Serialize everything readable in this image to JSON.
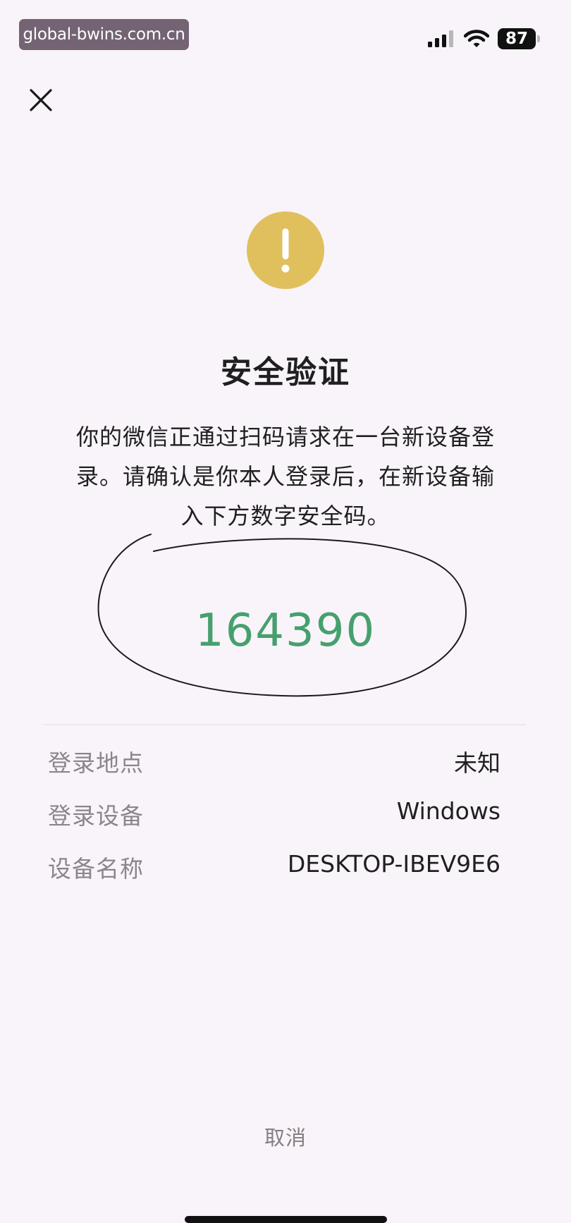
{
  "status_bar": {
    "watermark": "global-bwins.com.cn",
    "battery": "87"
  },
  "dialog": {
    "title": "安全验证",
    "description_lines": [
      "你的微信正通过扫码请求在一台新设备登",
      "录。请确认是你本人登录后，在新设备输",
      "入下方数字安全码。"
    ],
    "security_code": "164390"
  },
  "login_info": [
    {
      "label": "登录地点",
      "value": "未知"
    },
    {
      "label": "登录设备",
      "value": "Windows"
    },
    {
      "label": "设备名称",
      "value": "DESKTOP-IBEV9E6"
    }
  ],
  "cancel_label": "取消",
  "colors": {
    "warning": "#e0c05d",
    "code": "#46a06e",
    "background": "#f8f4f9"
  }
}
